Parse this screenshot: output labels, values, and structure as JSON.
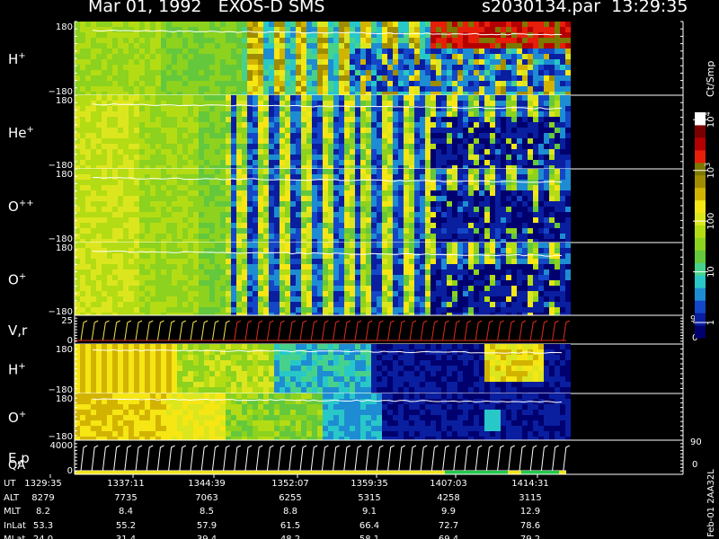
{
  "header": {
    "title": "Mar 01, 1992   EXOS-D SMS",
    "file": "s2030134.par  13:29:35"
  },
  "colors": {
    "background": "#000000",
    "text": "#ffffff",
    "vr_red": "#e02a1a",
    "vr_yellow": "#f4e64a",
    "qa_green": "#22c84a",
    "qa_yellow": "#f2e41c"
  },
  "colorbar": {
    "unit": "Ct/Smp",
    "ticks": [
      {
        "label": "1",
        "value": 1
      },
      {
        "label": "10",
        "value": 10
      },
      {
        "label": "100",
        "value": 100
      },
      {
        "label": "10",
        "sup": "3",
        "value": 1000
      },
      {
        "label": "10",
        "sup": "4",
        "value": 10000
      }
    ],
    "range": [
      0.5,
      14000
    ],
    "scale": "log",
    "palette": [
      "#00006e",
      "#0a1ea0",
      "#1446c8",
      "#1e8cd2",
      "#28c8c8",
      "#46d28c",
      "#64c83c",
      "#8cd21e",
      "#b4dc14",
      "#dce61e",
      "#f5e614",
      "#d2b400",
      "#a08c00",
      "#7c7800",
      "#e61e0a",
      "#b40000",
      "#7a0000",
      "#ffffff"
    ]
  },
  "chart_data": [
    {
      "type": "heatmap",
      "name": "H+",
      "label": "H",
      "sup": "+",
      "yticks": [
        "180",
        "−180"
      ],
      "ylim": [
        -180,
        180
      ]
    },
    {
      "type": "heatmap",
      "name": "He+",
      "label": "He",
      "sup": "+",
      "yticks": [
        "180",
        "−180"
      ],
      "ylim": [
        -180,
        180
      ]
    },
    {
      "type": "heatmap",
      "name": "O++",
      "label": "O",
      "sup": "++",
      "yticks": [
        "180",
        "−180"
      ],
      "ylim": [
        -180,
        180
      ]
    },
    {
      "type": "heatmap",
      "name": "O+",
      "label": "O",
      "sup": "+",
      "yticks": [
        "180",
        "−180"
      ],
      "ylim": [
        -180,
        180
      ]
    },
    {
      "type": "line",
      "name": "V,r",
      "label": "V,r",
      "yticks": [
        "25",
        "0"
      ],
      "ylim": [
        0,
        25
      ],
      "right_ticks": [
        "90",
        "0"
      ]
    },
    {
      "type": "heatmap",
      "name": "H+ (lower)",
      "label": "H",
      "sup": "+",
      "yticks": [
        "180",
        "−180"
      ],
      "ylim": [
        -180,
        180
      ]
    },
    {
      "type": "heatmap",
      "name": "O+ (lower)",
      "label": "O",
      "sup": "+",
      "yticks": [
        "180",
        "−180"
      ],
      "ylim": [
        -180,
        180
      ]
    },
    {
      "type": "line",
      "name": "E,p",
      "label": "E,p",
      "label2": "QA",
      "yticks": [
        "4000",
        "0"
      ],
      "ylim": [
        0,
        4000
      ],
      "right_ticks": [
        "90",
        "0"
      ]
    }
  ],
  "time_axis": {
    "row_labels": [
      "UT",
      "ALT",
      "MLT",
      "InLat",
      "MLat"
    ],
    "columns": [
      {
        "UT": "1329:35",
        "ALT": "8279",
        "MLT": "8.2",
        "InLat": "53.3",
        "MLat": "24.0"
      },
      {
        "UT": "1337:11",
        "ALT": "7735",
        "MLT": "8.4",
        "InLat": "55.2",
        "MLat": "31.4"
      },
      {
        "UT": "1344:39",
        "ALT": "7063",
        "MLT": "8.5",
        "InLat": "57.9",
        "MLat": "39.4"
      },
      {
        "UT": "1352:07",
        "ALT": "6255",
        "MLT": "8.8",
        "InLat": "61.5",
        "MLat": "48.2"
      },
      {
        "UT": "1359:35",
        "ALT": "5315",
        "MLT": "9.1",
        "InLat": "66.4",
        "MLat": "58.1"
      },
      {
        "UT": "1407:03",
        "ALT": "4258",
        "MLT": "9.9",
        "InLat": "72.7",
        "MLat": "69.4"
      },
      {
        "UT": "1414:31",
        "ALT": "3115",
        "MLT": "12.9",
        "InLat": "78.6",
        "MLat": "79.2"
      }
    ]
  },
  "footer": {
    "date_code": "Feb-01 2AA32L"
  }
}
